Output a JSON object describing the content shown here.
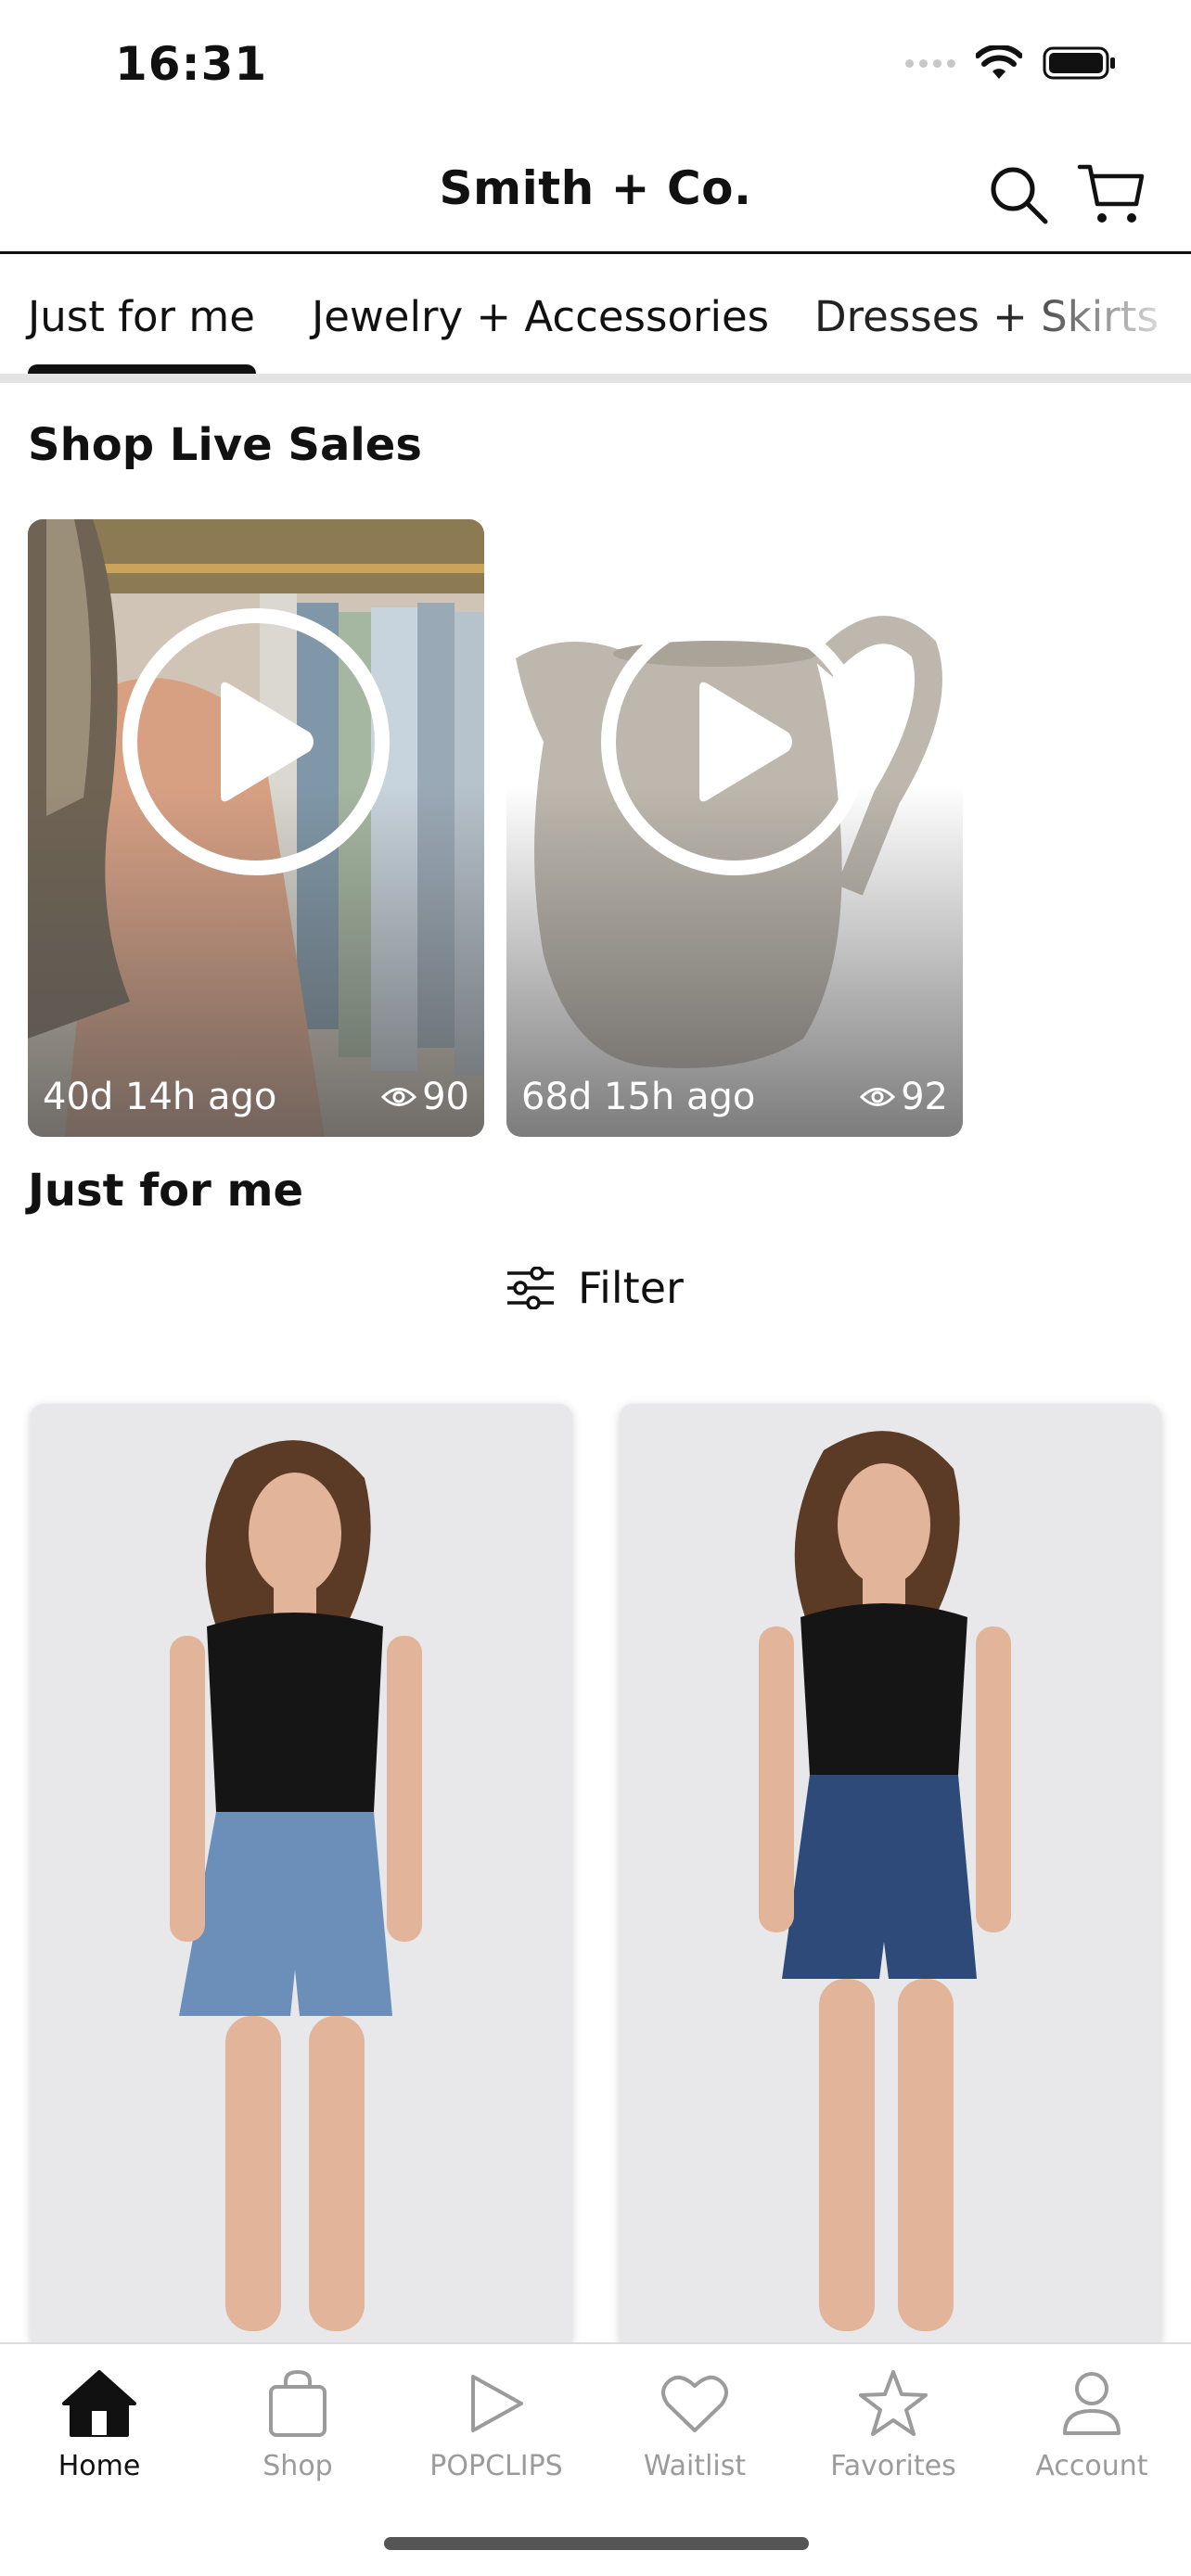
{
  "status_bar": {
    "time": "16:31"
  },
  "header": {
    "brand": "Smith + Co."
  },
  "tabs": [
    {
      "label": "Just for me",
      "active": true
    },
    {
      "label": "Jewelry + Accessories",
      "active": false
    },
    {
      "label": "Dresses + Skirts",
      "active": false
    }
  ],
  "live_sales": {
    "title": "Shop Live Sales",
    "cards": [
      {
        "time_ago": "40d 14h ago",
        "views": "90"
      },
      {
        "time_ago": "68d 15h ago",
        "views": "92"
      }
    ]
  },
  "just_for_me": {
    "title": "Just for me",
    "filter_label": "Filter"
  },
  "bottom_nav": [
    {
      "label": "Home",
      "icon": "home-icon",
      "active": true
    },
    {
      "label": "Shop",
      "icon": "shopping-bag-icon",
      "active": false
    },
    {
      "label": "POPCLIPS",
      "icon": "play-icon",
      "active": false
    },
    {
      "label": "Waitlist",
      "icon": "heart-icon",
      "active": false
    },
    {
      "label": "Favorites",
      "icon": "star-icon",
      "active": false
    },
    {
      "label": "Account",
      "icon": "person-icon",
      "active": false
    }
  ],
  "colors": {
    "text": "#111111",
    "inactive": "#9b9b9b",
    "divider": "#e4e4e4"
  }
}
